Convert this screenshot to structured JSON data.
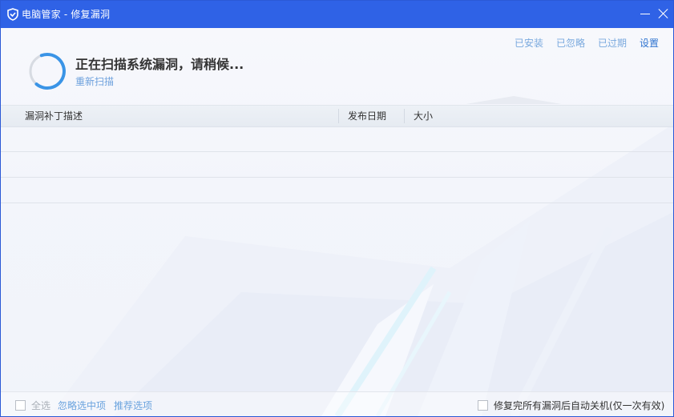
{
  "window": {
    "title": "电脑管家 - 修复漏洞",
    "icon": "shield-icon",
    "brand_color": "#2f62e6"
  },
  "top_links": [
    {
      "label": "已安装"
    },
    {
      "label": "已忽略"
    },
    {
      "label": "已过期"
    },
    {
      "label": "设置"
    }
  ],
  "scan": {
    "status": "正在扫描系统漏洞，请稍候...",
    "rescan_label": "重新扫描"
  },
  "table": {
    "columns": [
      "漏洞补丁描述",
      "发布日期",
      "大小"
    ],
    "rows": []
  },
  "footer": {
    "select_all_label": "全选",
    "ignore_selected_label": "忽略选中项",
    "recommend_label": "推荐选项",
    "auto_shutdown_label": "修复完所有漏洞后自动关机(仅一次有效)"
  }
}
